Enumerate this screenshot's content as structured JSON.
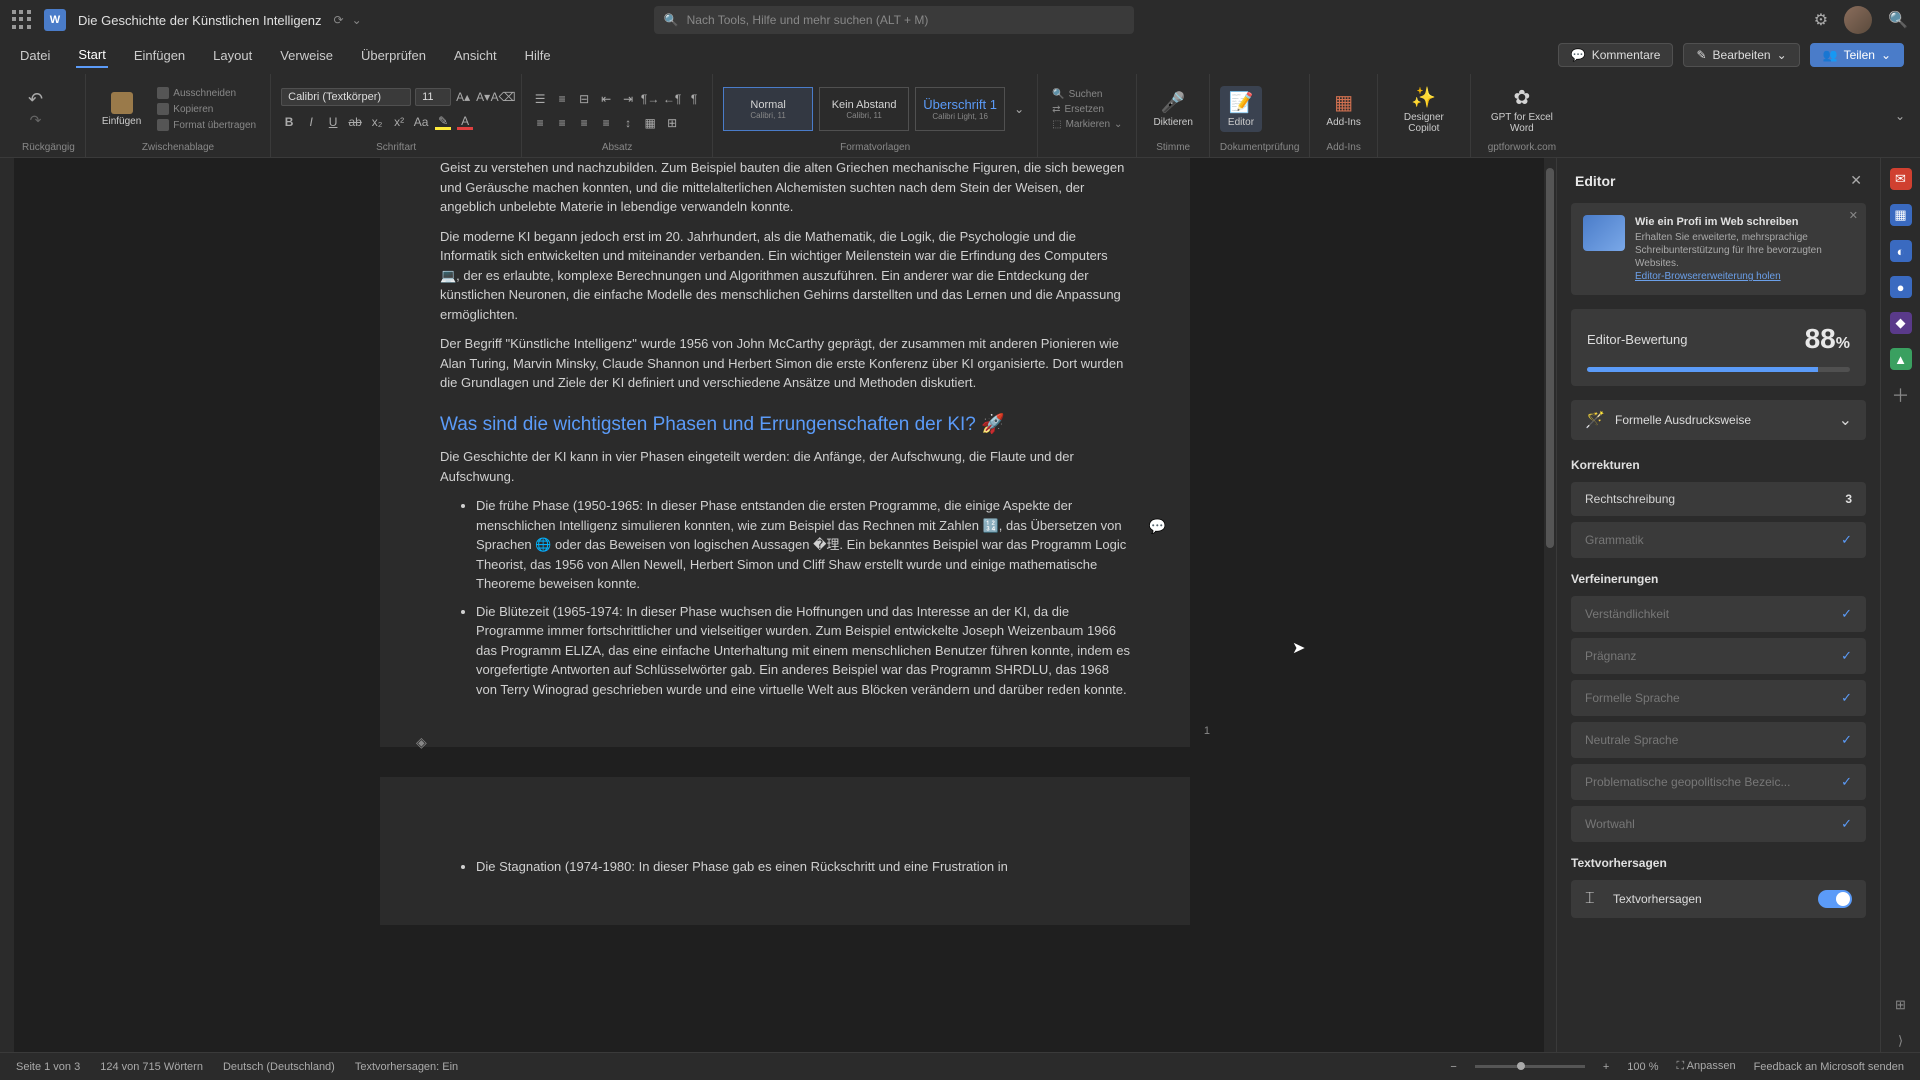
{
  "titlebar": {
    "word_glyph": "W",
    "doc_title": "Die Geschichte der Künstlichen Intelligenz",
    "search_placeholder": "Nach Tools, Hilfe und mehr suchen (ALT + M)"
  },
  "menubar": {
    "items": [
      "Datei",
      "Start",
      "Einfügen",
      "Layout",
      "Verweise",
      "Überprüfen",
      "Ansicht",
      "Hilfe"
    ],
    "active_index": 1,
    "comments_label": "Kommentare",
    "edit_label": "Bearbeiten",
    "share_label": "Teilen"
  },
  "ribbon": {
    "undo_label": "Rückgängig",
    "paste_label": "Einfügen",
    "clipboard_group": "Zwischenablage",
    "cut_label": "Ausschneiden",
    "copy_label": "Kopieren",
    "format_painter": "Format übertragen",
    "font_name": "Calibri (Textkörper)",
    "font_size": "11",
    "font_group": "Schriftart",
    "para_group": "Absatz",
    "styles_group": "Formatvorlagen",
    "styles": [
      {
        "name": "Normal",
        "sub": "Calibri, 11"
      },
      {
        "name": "Kein Abstand",
        "sub": "Calibri, 11"
      },
      {
        "name": "Überschrift 1",
        "sub": "Calibri Light, 16"
      }
    ],
    "search_label": "Suchen",
    "replace_label": "Ersetzen",
    "select_label": "Markieren",
    "dictate_label": "Diktieren",
    "voice_group": "Stimme",
    "editor_label": "Editor",
    "editor_group": "Dokumentprüfung",
    "addins_label": "Add-Ins",
    "addins_group": "Add-Ins",
    "designer_label": "Designer Copilot",
    "gpt_label": "GPT for Excel Word",
    "gpt_group": "gptforwork.com"
  },
  "document": {
    "para1": "Geist zu verstehen und nachzubilden. Zum Beispiel bauten die alten Griechen mechanische Figuren, die sich bewegen und Geräusche machen konnten, und die mittelalterlichen Alchemisten suchten nach dem Stein der Weisen, der angeblich unbelebte Materie in lebendige verwandeln konnte.",
    "para2": "Die moderne KI begann jedoch erst im 20. Jahrhundert, als die Mathematik, die Logik, die Psychologie und die Informatik sich entwickelten und miteinander verbanden. Ein wichtiger Meilenstein war die Erfindung des Computers 💻, der es erlaubte, komplexe Berechnungen und Algorithmen auszuführen. Ein anderer war die Entdeckung der künstlichen Neuronen, die einfache Modelle des menschlichen Gehirns darstellten und das Lernen und die Anpassung ermöglichten.",
    "para3": "Der Begriff \"Künstliche Intelligenz\" wurde 1956 von John McCarthy geprägt, der zusammen mit anderen Pionieren wie Alan Turing, Marvin Minsky, Claude Shannon und Herbert Simon die erste Konferenz über KI organisierte. Dort wurden die Grundlagen und Ziele der KI definiert und verschiedene Ansätze und Methoden diskutiert.",
    "heading": "Was sind die wichtigsten Phasen und Errungenschaften der KI? 🚀",
    "intro": "Die Geschichte der KI kann in vier Phasen eingeteilt werden: die Anfänge, der Aufschwung, die Flaute und der Aufschwung.",
    "bullets": [
      "Die frühe Phase (1950-1965: In dieser Phase entstanden die ersten Programme, die einige Aspekte der menschlichen Intelligenz simulieren konnten, wie zum Beispiel das Rechnen mit Zahlen 🔢, das Übersetzen von Sprachen 🌐 oder das Beweisen von logischen Aussagen �理. Ein bekanntes Beispiel war das Programm Logic Theorist, das 1956 von Allen Newell, Herbert Simon und Cliff Shaw erstellt wurde und einige mathematische Theoreme beweisen konnte.",
      "Die Blütezeit (1965-1974: In dieser Phase wuchsen die Hoffnungen und das Interesse an der KI, da die Programme immer fortschrittlicher und vielseitiger wurden. Zum Beispiel entwickelte Joseph Weizenbaum 1966 das Programm ELIZA, das eine einfache Unterhaltung mit einem menschlichen Benutzer führen konnte, indem es vorgefertigte Antworten auf Schlüsselwörter gab. Ein anderes Beispiel war das Programm SHRDLU, das 1968 von Terry Winograd geschrieben wurde und eine virtuelle Welt aus Blöcken verändern und darüber reden konnte."
    ],
    "page_number": "1",
    "next_bullet": "Die Stagnation (1974-1980: In dieser Phase gab es einen Rückschritt und eine Frustration in"
  },
  "editor": {
    "title": "Editor",
    "promo_title": "Wie ein Profi im Web schreiben",
    "promo_text": "Erhalten Sie erweiterte, mehrsprachige Schreibunterstützung für Ihre bevorzugten Websites.",
    "promo_link": "Editor-Browsererweiterung holen",
    "score_label": "Editor-Bewertung",
    "score_value": "88",
    "score_pct": "%",
    "score_fill_pct": 88,
    "style_label": "Formelle Ausdrucksweise",
    "corrections_head": "Korrekturen",
    "spelling_label": "Rechtschreibung",
    "spelling_count": "3",
    "grammar_label": "Grammatik",
    "refinements_head": "Verfeinerungen",
    "refinements": [
      "Verständlichkeit",
      "Prägnanz",
      "Formelle Sprache",
      "Neutrale Sprache",
      "Problematische geopolitische Bezeic...",
      "Wortwahl"
    ],
    "predictions_head": "Textvorhersagen",
    "predictions_label": "Textvorhersagen"
  },
  "statusbar": {
    "page_info": "Seite 1 von 3",
    "word_count": "124 von 715 Wörtern",
    "language": "Deutsch (Deutschland)",
    "predictions": "Textvorhersagen: Ein",
    "fit": "Anpassen",
    "zoom": "100 %",
    "feedback": "Feedback an Microsoft senden"
  }
}
